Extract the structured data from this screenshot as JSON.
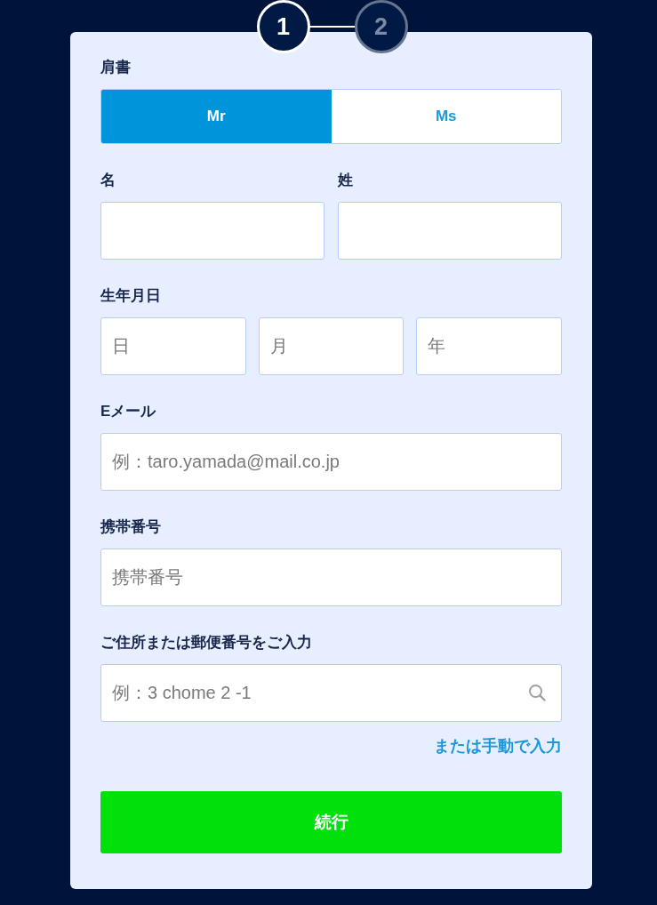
{
  "stepper": {
    "steps": [
      {
        "label": "1",
        "selected": true
      },
      {
        "label": "2",
        "selected": false
      }
    ]
  },
  "form": {
    "title_field": {
      "label": "肩書",
      "options": [
        {
          "label": "Mr",
          "selected": true
        },
        {
          "label": "Ms",
          "selected": false
        }
      ]
    },
    "name_fields": [
      {
        "label": "名"
      },
      {
        "label": "姓"
      }
    ],
    "birthdate": {
      "label": "生年月日",
      "fields": [
        {
          "placeholder": "日"
        },
        {
          "placeholder": "月"
        },
        {
          "placeholder": "年"
        }
      ]
    },
    "email": {
      "label": "Eメール",
      "placeholder": "例：taro.yamada@mail.co.jp"
    },
    "mobile": {
      "label": "携帯番号",
      "placeholder": "携帯番号"
    },
    "address": {
      "label": "ご住所または郵便番号をご入力",
      "placeholder": "例：3 chome 2 -1"
    },
    "manual_link": "または手動で入力",
    "continue_button": "続行"
  }
}
